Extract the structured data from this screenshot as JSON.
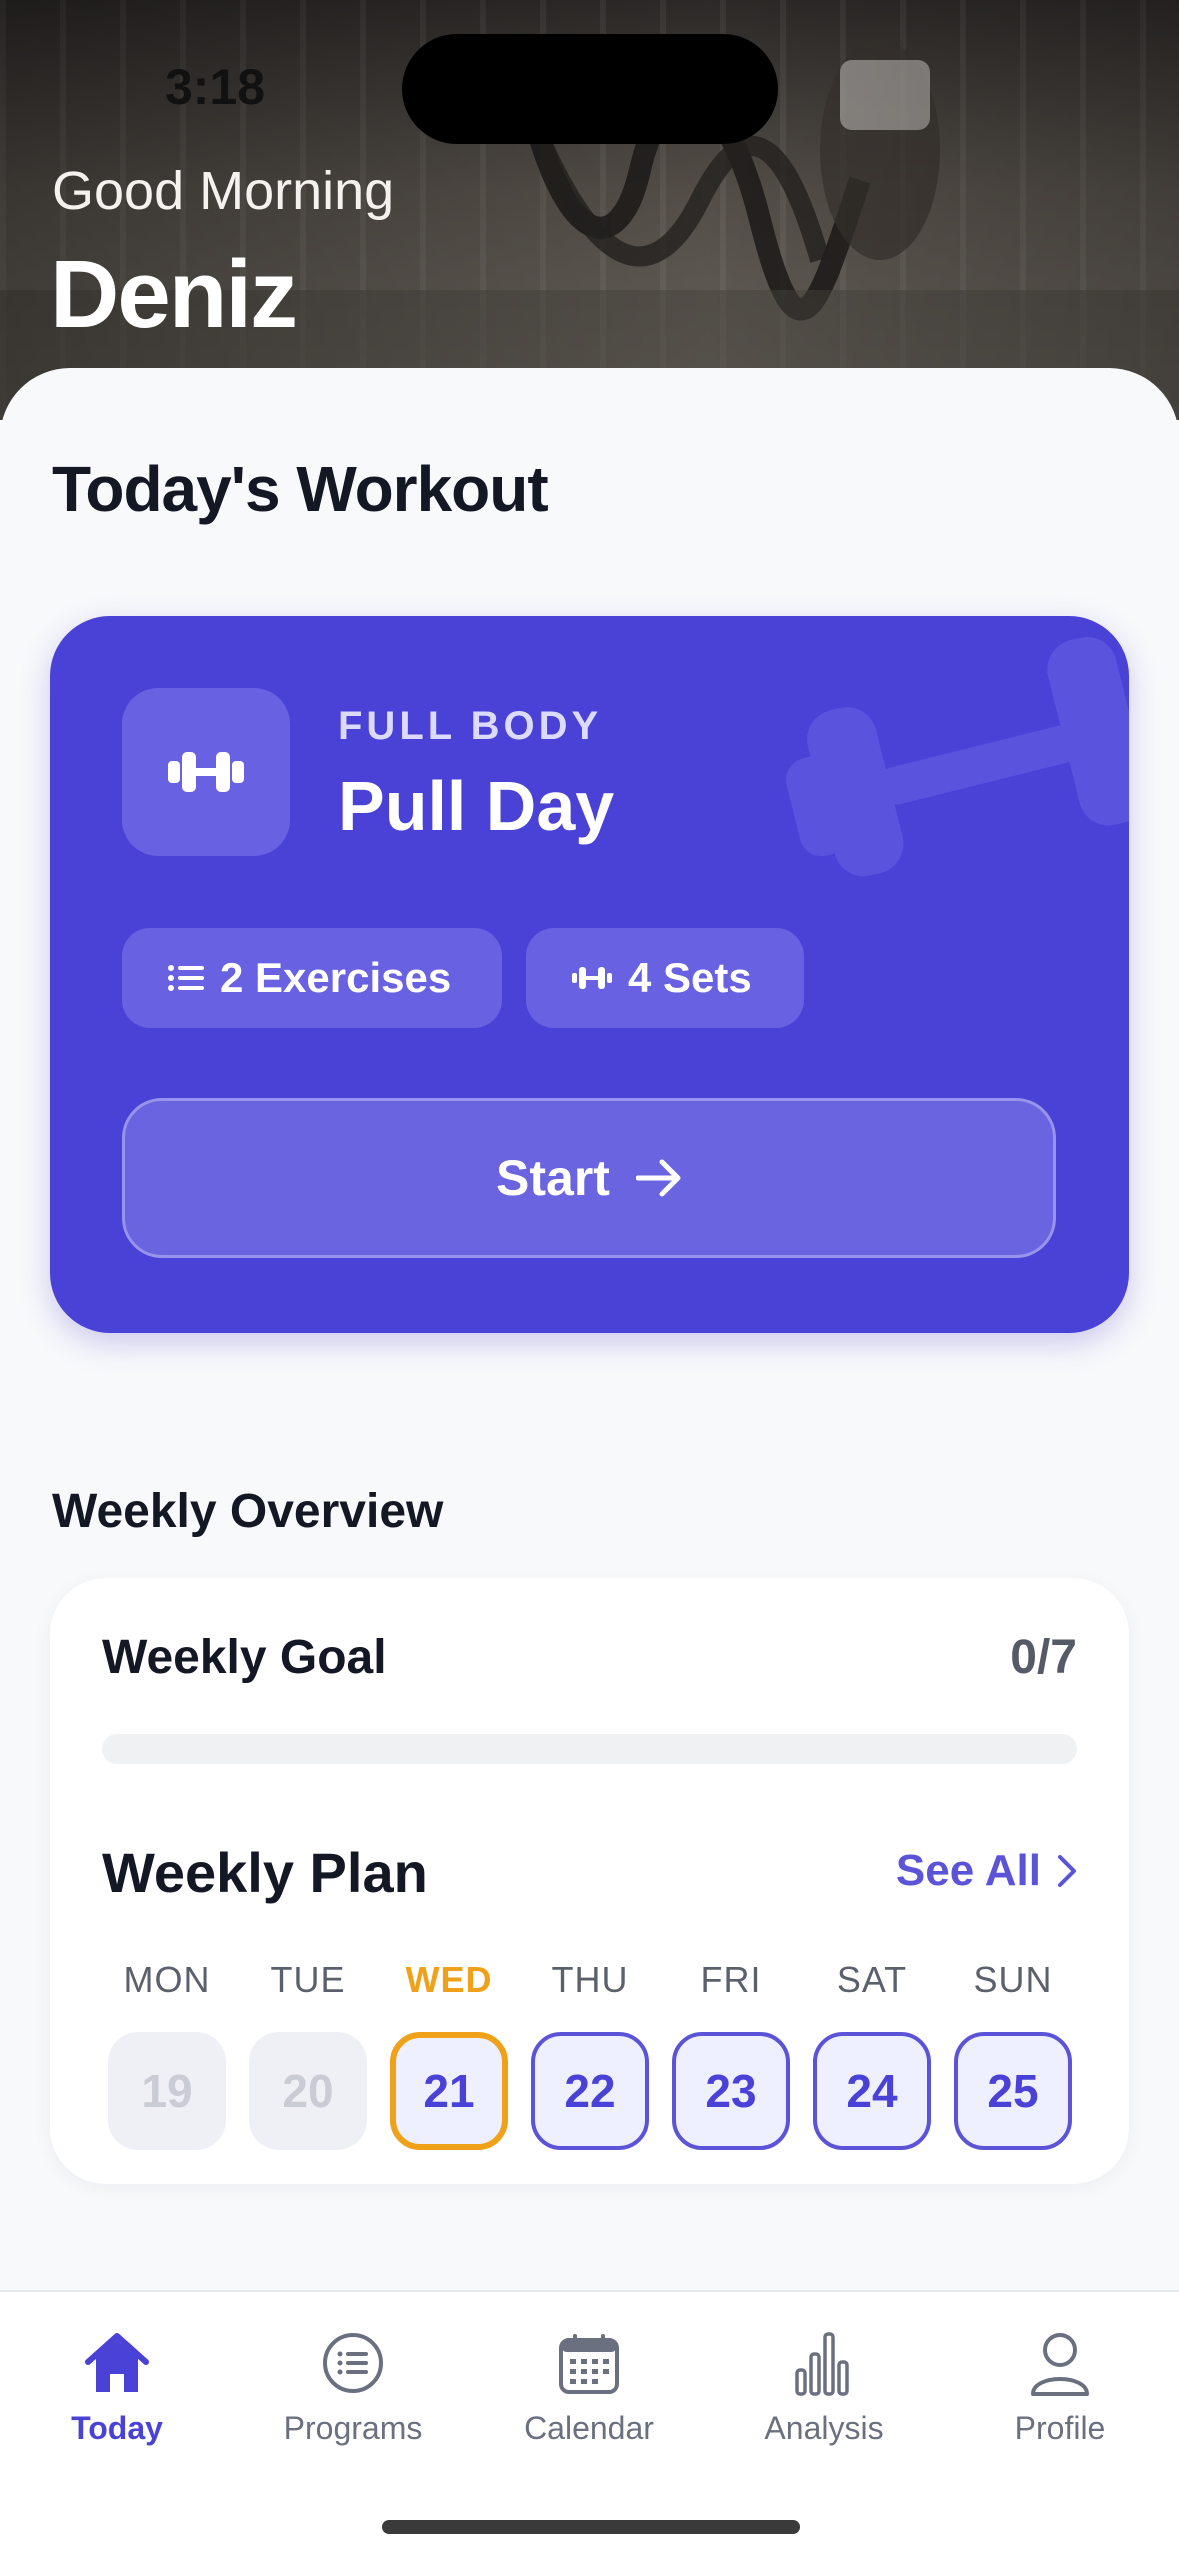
{
  "status_bar": {
    "time": "3:18"
  },
  "header": {
    "greeting": "Good Morning",
    "user_name": "Deniz"
  },
  "todays_workout": {
    "section_title": "Today's Workout",
    "category": "FULL BODY",
    "name": "Pull Day",
    "exercises_chip": "2 Exercises",
    "sets_chip": "4 Sets",
    "start_label": "Start",
    "accent_color": "#4a42d6"
  },
  "weekly_overview": {
    "section_title": "Weekly Overview",
    "goal_label": "Weekly Goal",
    "goal_value": "0/7",
    "goal_progress": 0,
    "plan_title": "Weekly Plan",
    "see_all_label": "See All",
    "days": [
      {
        "label": "MON",
        "date": "19",
        "state": "past"
      },
      {
        "label": "TUE",
        "date": "20",
        "state": "past"
      },
      {
        "label": "WED",
        "date": "21",
        "state": "today"
      },
      {
        "label": "THU",
        "date": "22",
        "state": "future"
      },
      {
        "label": "FRI",
        "date": "23",
        "state": "future"
      },
      {
        "label": "SAT",
        "date": "24",
        "state": "future"
      },
      {
        "label": "SUN",
        "date": "25",
        "state": "future"
      }
    ],
    "today_color": "#efa119"
  },
  "tab_bar": {
    "tabs": [
      {
        "label": "Today",
        "icon": "home-icon",
        "active": true
      },
      {
        "label": "Programs",
        "icon": "list-circle-icon",
        "active": false
      },
      {
        "label": "Calendar",
        "icon": "calendar-icon",
        "active": false
      },
      {
        "label": "Analysis",
        "icon": "bar-chart-icon",
        "active": false
      },
      {
        "label": "Profile",
        "icon": "person-icon",
        "active": false
      }
    ]
  }
}
